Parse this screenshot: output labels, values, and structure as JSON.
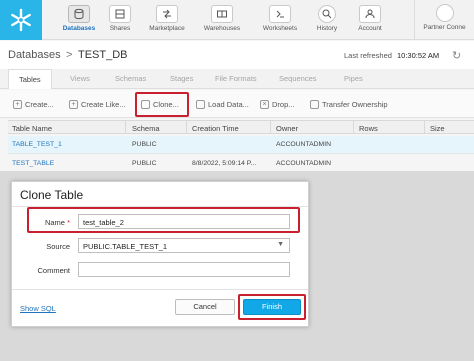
{
  "nav": {
    "items": [
      {
        "label": "Databases",
        "icon": "database-icon",
        "active": true
      },
      {
        "label": "Shares",
        "icon": "shares-icon",
        "active": false
      },
      {
        "label": "Marketplace",
        "icon": "marketplace-icon",
        "active": false
      },
      {
        "label": "Warehouses",
        "icon": "warehouse-icon",
        "active": false
      },
      {
        "label": "Worksheets",
        "icon": "worksheet-icon",
        "active": false
      },
      {
        "label": "History",
        "icon": "history-icon",
        "active": false
      },
      {
        "label": "Account",
        "icon": "account-icon",
        "active": false
      }
    ],
    "partner_label": "Partner Conne",
    "brand_color": "#29b5e8"
  },
  "breadcrumb": {
    "root": "Databases",
    "separator": ">",
    "current": "TEST_DB",
    "refresh_label": "Last refreshed",
    "refresh_time": "10:30:52 AM"
  },
  "tabs": [
    "Tables",
    "Views",
    "Schemas",
    "Stages",
    "File Formats",
    "Sequences",
    "Pipes"
  ],
  "toolbar": {
    "create": "Create...",
    "create_like": "Create Like...",
    "clone": "Clone...",
    "load_data": "Load Data...",
    "drop": "Drop...",
    "transfer": "Transfer Ownership"
  },
  "table": {
    "columns": [
      "Table Name",
      "Schema",
      "Creation Time",
      "Owner",
      "Rows",
      "Size"
    ],
    "rows": [
      {
        "name": "TABLE_TEST_1",
        "schema": "PUBLIC",
        "created": "",
        "owner": "ACCOUNTADMIN",
        "selected": true
      },
      {
        "name": "TEST_TABLE",
        "schema": "PUBLIC",
        "created": "8/8/2022, 5:09:14 P...",
        "owner": "ACCOUNTADMIN",
        "selected": false
      }
    ]
  },
  "modal": {
    "title": "Clone Table",
    "name_label": "Name",
    "required_marker": "*",
    "name_value": "test_table_2",
    "source_label": "Source",
    "source_value": "PUBLIC.TABLE_TEST_1",
    "comment_label": "Comment",
    "comment_value": "",
    "show_sql": "Show SQL",
    "cancel": "Cancel",
    "finish": "Finish"
  },
  "colors": {
    "highlight": "#c9202f",
    "primary": "#12a7e6",
    "link": "#1e73be"
  }
}
